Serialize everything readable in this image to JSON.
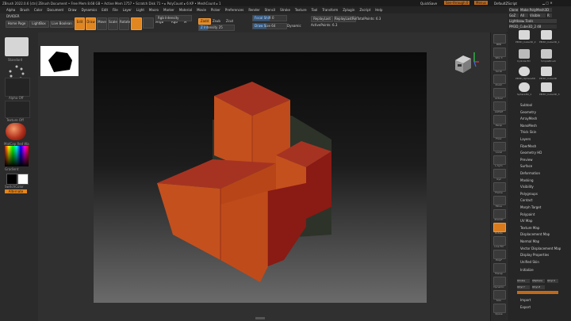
{
  "titlebar": {
    "title": "ZBrush 2022.0.6 [ctn]   ZBrush Document   • Free Mem 8.68 GB • Active Mem 1757 • Scratch Disk 71 • ▸ PolyCount ▸ 6 KP • MeshCount ▸ 1",
    "quicksave": "QuickSave",
    "seethrough": "See-through 0",
    "menus": "Menus",
    "defaultscript": "DefaultZScript"
  },
  "menubar": {
    "items": [
      "Alpha",
      "Brush",
      "Color",
      "Document",
      "Draw",
      "Dynamics",
      "Edit",
      "File",
      "Layer",
      "Light",
      "Macro",
      "Marker",
      "Material",
      "Movie",
      "Picker",
      "Preferences",
      "Render",
      "Stencil",
      "Stroke",
      "Texture",
      "Tool",
      "Transform",
      "Zplugin",
      "Zscript",
      "Help"
    ]
  },
  "toolbar": {
    "section": "DIVIDER",
    "home_page": "Home Page",
    "lightbox": "LightBox",
    "live_boolean": "Live Boolean",
    "edit": "Edit",
    "draw": "Draw",
    "move": "Move",
    "scale": "Scale",
    "rotate": "Rotate",
    "mrgb": "Mrgb",
    "rgb": "Rgb",
    "m": "M",
    "zadd": "Zadd",
    "zsub": "Zsub",
    "zcut": "Zcut",
    "rgb_intensity": "Rgb Intensity",
    "z_intensity": "Z Intensity  25",
    "focal_shift": "Focal Shift  0",
    "draw_size": "Draw Size  64",
    "dynamic": "Dynamic",
    "active_points": "ActivePoints: 6.3",
    "total_points": "TotalPoints: 6.3",
    "replay_last": "ReplayLast",
    "replay_last_rel": "ReplayLastRel"
  },
  "leftpanel": {
    "items": [
      "Standard",
      "Dots",
      "Alpha Off",
      "Texture Off",
      "MatCap Red Wa",
      "Gradient",
      "SwitchColor",
      "Alternate"
    ]
  },
  "rightbar": {
    "labels": [
      "BPR",
      "SPix 3",
      "Scroll",
      "Zoom",
      "Actual",
      "AAHalf",
      "Persp",
      "Floor",
      "Local",
      "L.Sym",
      "Gyz",
      "Frame",
      "Move",
      "ZoomD",
      "Rotate",
      "Line Fill",
      "PolyF",
      "Transp",
      "Dynamic",
      "Solo",
      "Xpose"
    ]
  },
  "rightpanel": {
    "header": [
      "Clone",
      "Make PolyMesh3D",
      "GoZ",
      "All",
      "Visible",
      "R"
    ],
    "lightbox_tools": "Lightbox▸ Tools",
    "current_tool": "PM3D_Cube3D_2  48",
    "tools": [
      "PM3D_Cube3D_2",
      "PM3D_Cube3D_1",
      "Cylinder3D",
      "SimpleBrush",
      "PM3D_Sphere3D",
      "PM3D_Cube3D",
      "Sphere3D_1",
      "PM3D_Cube3D_3",
      "PM3D_Cube3D_5",
      "PM3D_Cube3D_4"
    ],
    "menu": [
      "Subtool",
      "Geometry",
      "ArrayMesh",
      "NanoMesh",
      "Thick Skin",
      "Layers",
      "FiberMesh",
      "Geometry HD",
      "Preview",
      "Surface",
      "Deformation",
      "Masking",
      "Visibility",
      "Polygroups",
      "Contact",
      "Morph Target",
      "Polypaint",
      "UV Map",
      "Texture Map",
      "Displacement Map",
      "Normal Map",
      "Vector Displacement Map",
      "Display Properties",
      "Unified Skin",
      "Initialize",
      "Import",
      "Export"
    ],
    "init_buttons": [
      "QCube",
      "QSphere",
      "QCyl X",
      "QCyl Y",
      "QCyl Z",
      "QCyl X"
    ]
  },
  "colors": {
    "accent": "#e2861f",
    "cube_face_light": "#c4501e",
    "cube_face_dark": "#8a1a14",
    "cube_top": "#a63322"
  }
}
